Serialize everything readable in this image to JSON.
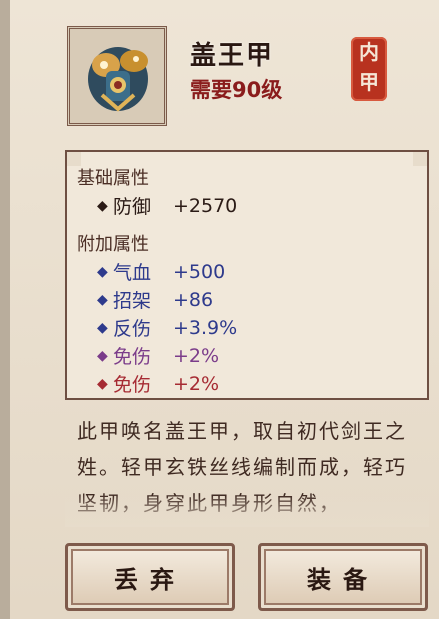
{
  "item": {
    "name": "盖王甲",
    "requirement": "需要90级",
    "icon": "armor-icon",
    "seal_text": [
      "内",
      "甲"
    ],
    "seal_color": "#b8321f"
  },
  "base_section": {
    "title": "基础属性",
    "rows": [
      {
        "name": "防御",
        "value": "+2570"
      }
    ]
  },
  "extra_section": {
    "title": "附加属性",
    "rows": [
      {
        "name": "气血",
        "value": "+500",
        "color": "#2e3a8c"
      },
      {
        "name": "招架",
        "value": "+86",
        "color": "#2e3a8c"
      },
      {
        "name": "反伤",
        "value": "+3.9%",
        "color": "#2e3a8c"
      },
      {
        "name": "免伤",
        "value": "+2%",
        "color": "#7b3c8a"
      },
      {
        "name": "免伤",
        "value": "+2%",
        "color": "#a62b33"
      }
    ]
  },
  "description": "此甲唤名盖王甲，取自初代剑王之姓。轻甲玄铁丝线编制而成，轻巧坚韧，身穿此甲身形自然，",
  "buttons": {
    "discard": "丢弃",
    "equip": "装备"
  }
}
